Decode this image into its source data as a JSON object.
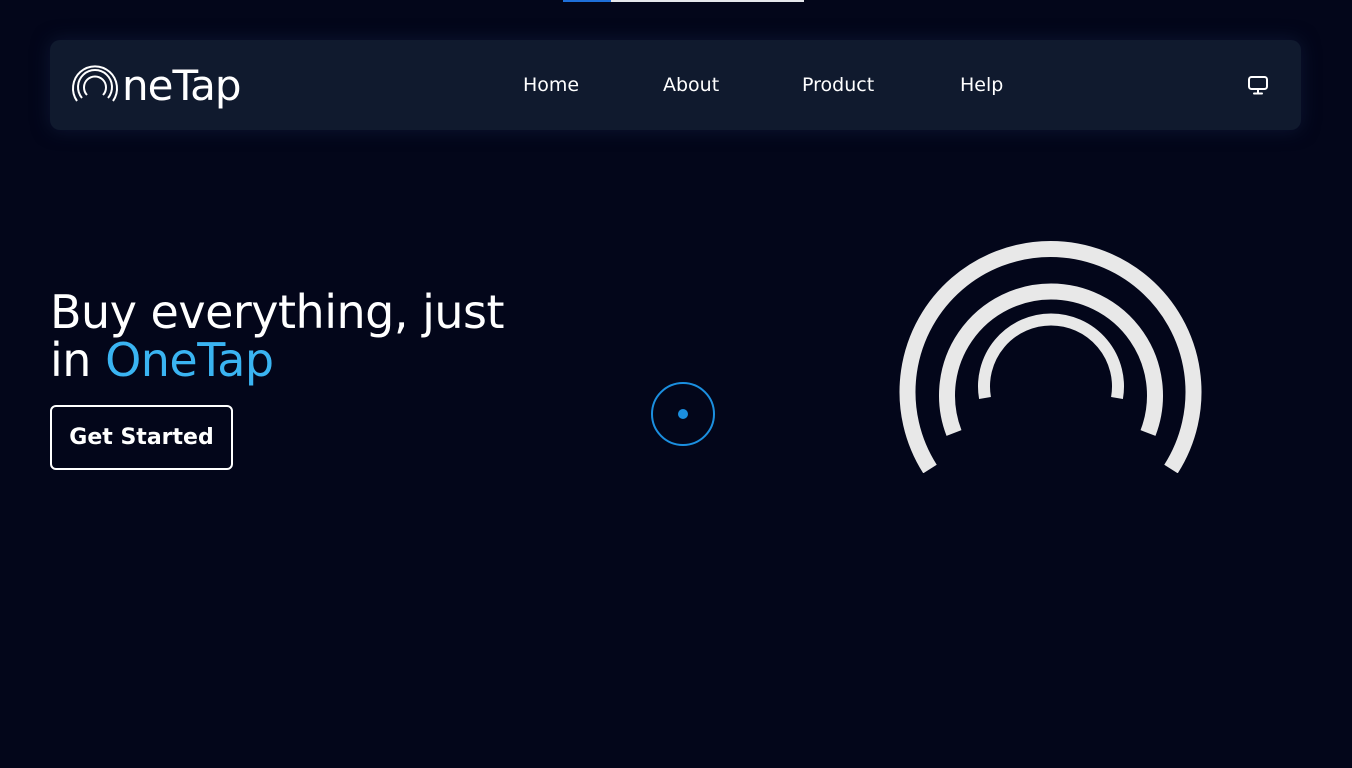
{
  "progress": {
    "value_fraction": 0.2,
    "fill_color": "#1e6fd9",
    "track_color": "#e5e7eb"
  },
  "navbar": {
    "logo": {
      "icon": "signal-arcs-icon",
      "text": "neTap"
    },
    "links": [
      {
        "label": "Home"
      },
      {
        "label": "About"
      },
      {
        "label": "Product"
      },
      {
        "label": "Help"
      }
    ],
    "theme_toggle_icon": "monitor-icon"
  },
  "hero": {
    "heading_line1": "Buy everything, just",
    "heading_line2_prefix": "in ",
    "heading_accent": "OneTap",
    "cta_label": "Get Started",
    "graphic_icon": "signal-arcs-icon"
  },
  "colors": {
    "background": "#03061a",
    "navbar": "#101a2e",
    "accent": "#3ab4f2",
    "cursor": "#1b8fe0",
    "graphic": "#e8e8e8"
  }
}
